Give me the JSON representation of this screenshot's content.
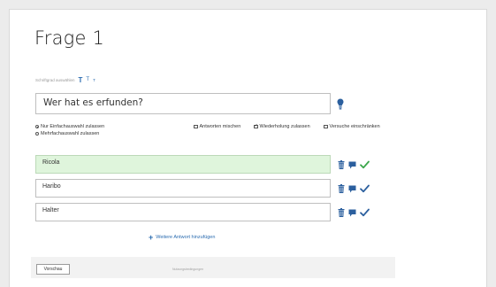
{
  "page": {
    "title": "Frage 1"
  },
  "font_size": {
    "label": "Schriftgrad auswählen",
    "large": "T",
    "medium": "T",
    "small": "T"
  },
  "question": {
    "value": "Wer hat es erfunden?"
  },
  "answer_mode": {
    "single": {
      "label": "Nur Einfachauswahl zulassen",
      "selected": true
    },
    "multiple": {
      "label": "Mehrfachauswahl zulassen",
      "selected": false
    }
  },
  "options": {
    "shuffle": {
      "label": "Antworten mischen",
      "checked": false
    },
    "repeat": {
      "label": "Wiederholung zulassen",
      "checked": true
    },
    "limit": {
      "label": "Versuche einschränken",
      "checked": false
    }
  },
  "answers": [
    {
      "text": "Ricola",
      "correct": true
    },
    {
      "text": "Haribo",
      "correct": false
    },
    {
      "text": "Halter",
      "correct": false
    }
  ],
  "add_answer": {
    "label": "Weitere Antwort hinzufügen"
  },
  "footer": {
    "preview": "Vorschau",
    "terms": "Nutzungsbedingungen"
  },
  "colors": {
    "accent": "#2b6cb0",
    "correct_bg": "#dff5dc",
    "check_green": "#3aa64a",
    "icon_blue": "#2b5f9e"
  }
}
